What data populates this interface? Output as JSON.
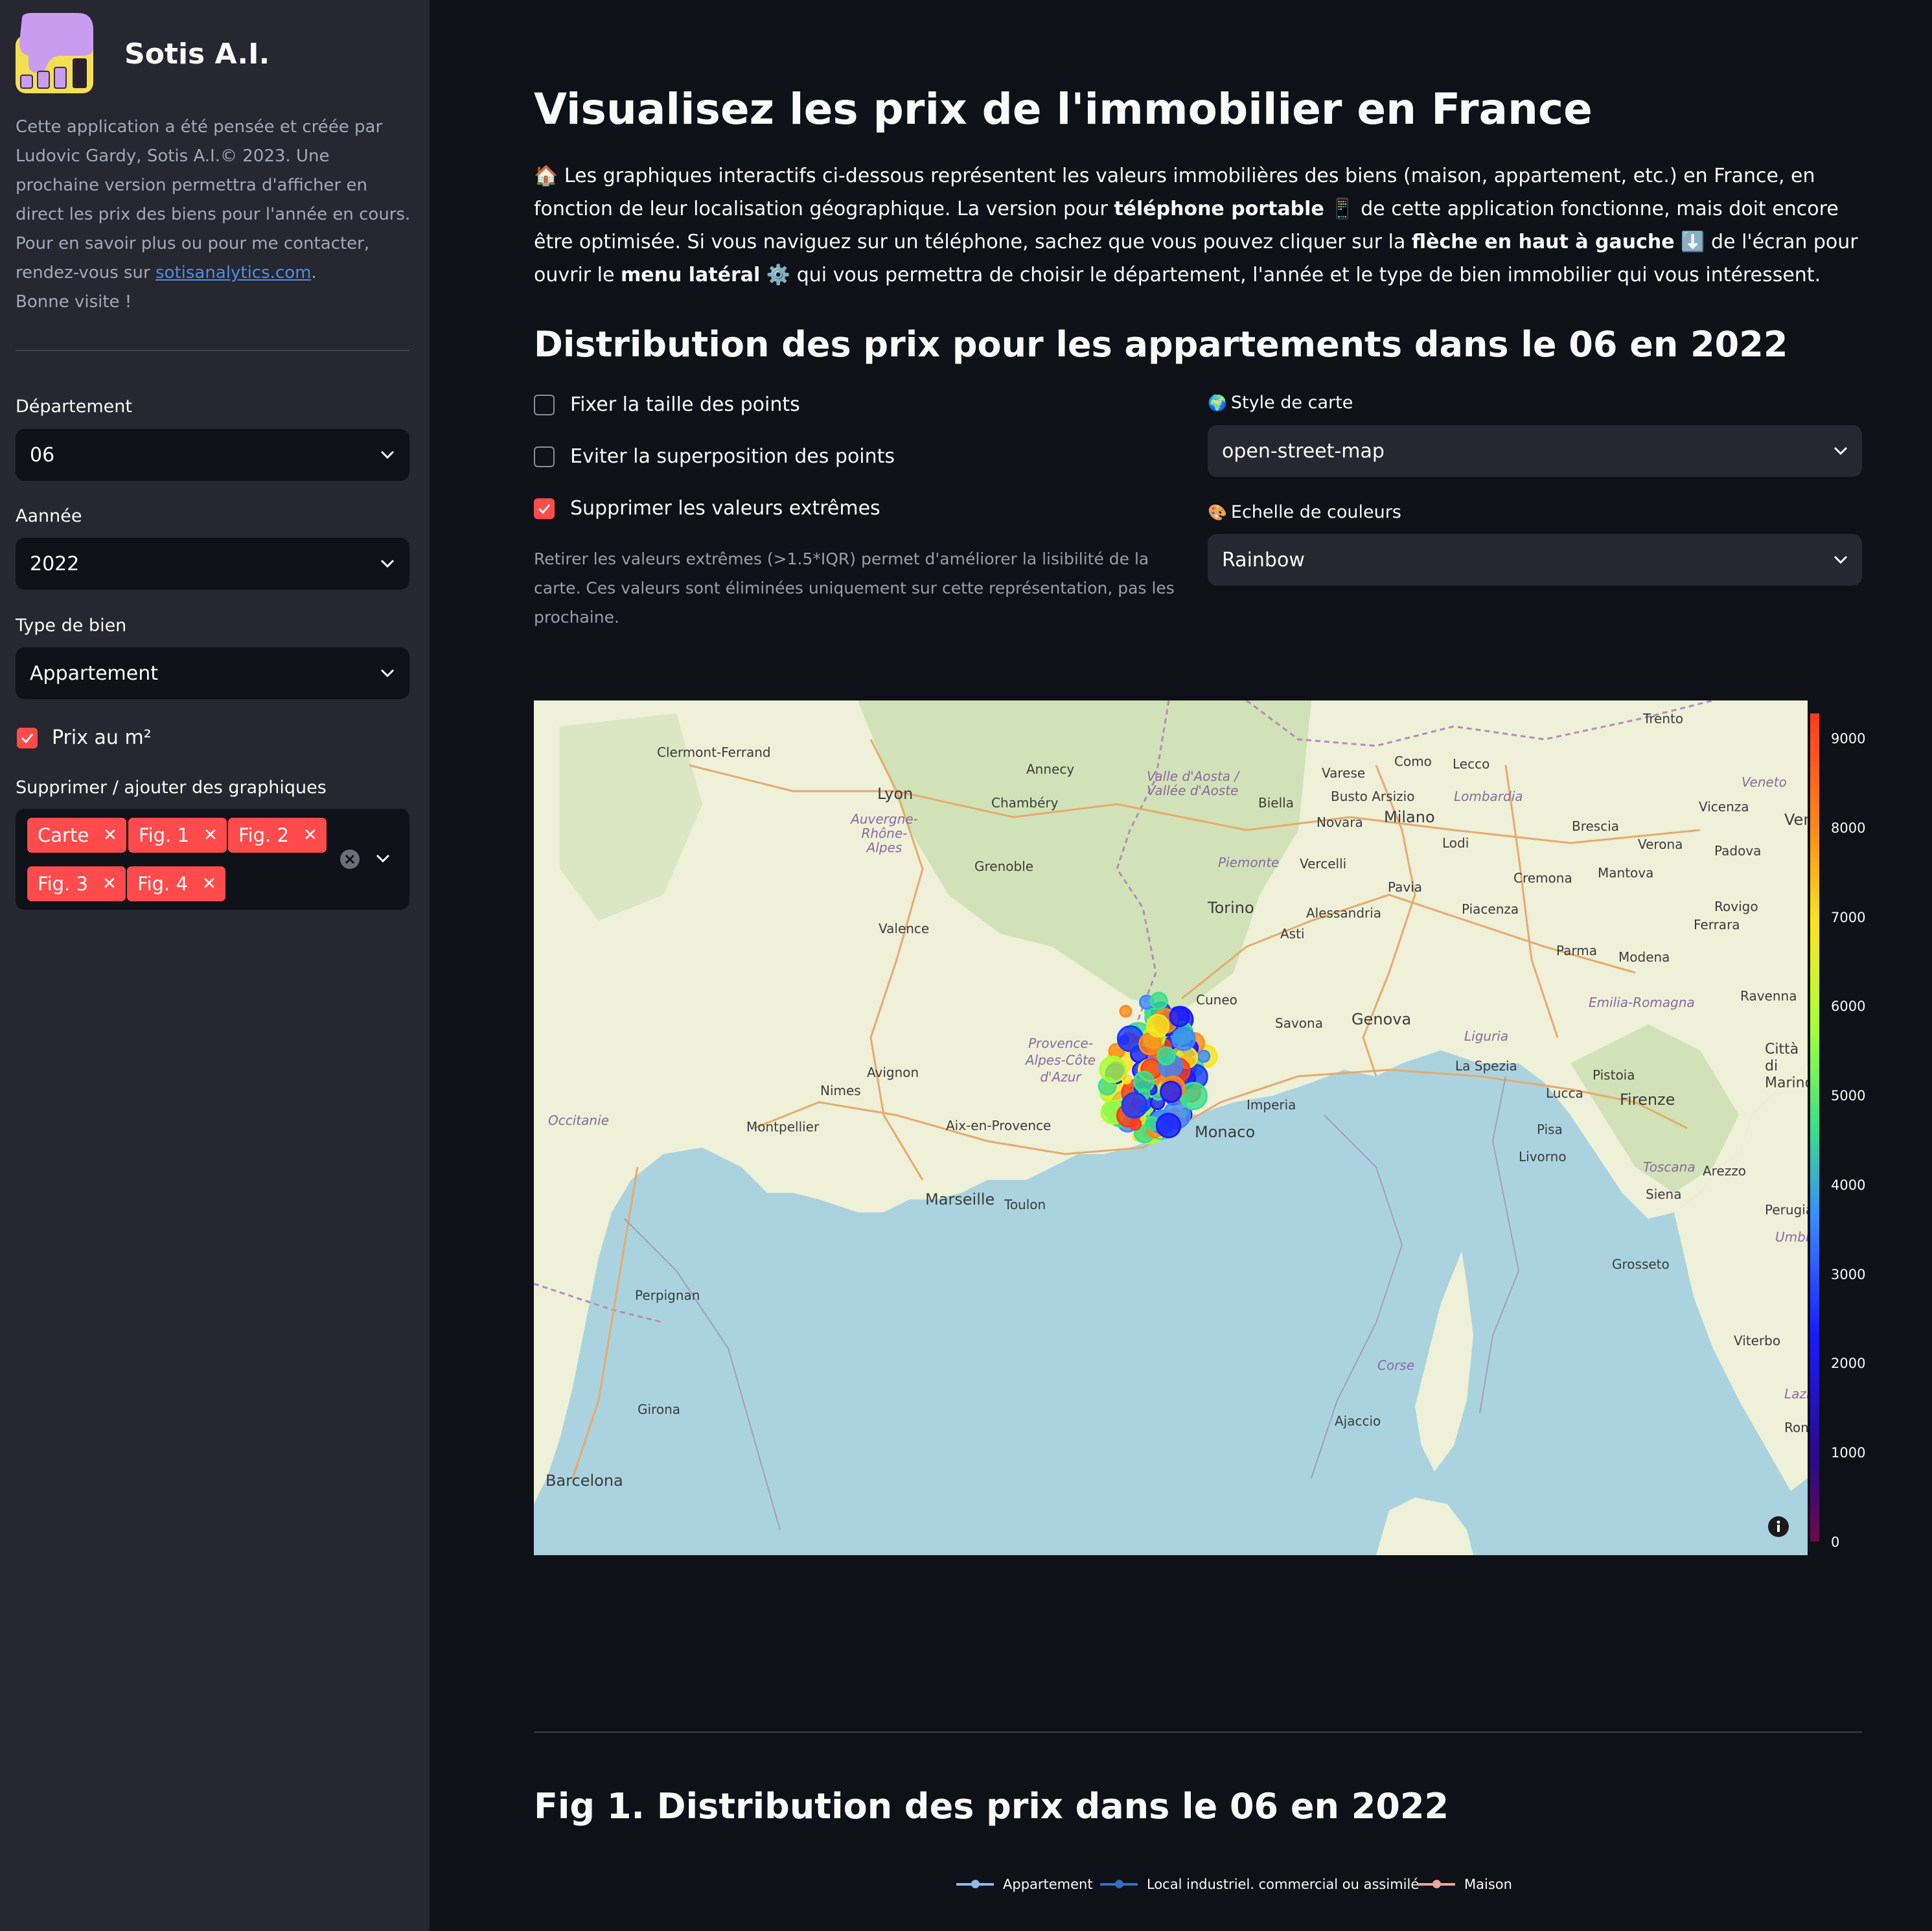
{
  "sidebar": {
    "brand": "Sotis A.I.",
    "intro_text": "Cette application a été pensée et créée par Ludovic Gardy, Sotis A.I.© 2023. Une prochaine version permettra d'afficher en direct les prix des biens pour l'année en cours. Pour en savoir plus ou pour me contacter, rendez-vous sur ",
    "intro_link": "sotisanalytics.com",
    "intro_after": ".",
    "intro_end": "Bonne visite !",
    "departement_label": "Département",
    "departement_value": "06",
    "annee_label": "Aannée",
    "annee_value": "2022",
    "type_label": "Type de bien",
    "type_value": "Appartement",
    "prix_m2_label": "Prix au m²",
    "prix_m2_checked": true,
    "graphs_label": "Supprimer / ajouter des graphiques",
    "graph_tags": [
      "Carte",
      "Fig. 1",
      "Fig. 2",
      "Fig. 3",
      "Fig. 4"
    ]
  },
  "main": {
    "title": "Visualisez les prix de l'immobilier en France",
    "intro": {
      "icon": "🏠",
      "p1": " Les graphiques interactifs ci-dessous représentent les valeurs immobilières des biens (maison, appartement, etc.) en France, en fonction de leur localisation géographique. La version pour ",
      "b1": "téléphone portable",
      "icon2": "📱",
      "p2": " de cette application fonctionne, mais doit encore être optimisée. Si vous naviguez sur un téléphone, sachez que vous pouvez cliquer sur la ",
      "b2": "flèche en haut à gauche",
      "icon3": "⬇️",
      "p3": " de l'écran pour ouvrir le ",
      "b3": "menu latéral",
      "icon4": "⚙️",
      "p4": " qui vous permettra de choisir le département, l'année et le type de bien immobilier qui vous intéressent."
    },
    "section_title": "Distribution des prix pour les appartements dans le 06 en 2022",
    "options": {
      "fix_size_label": "Fixer la taille des points",
      "fix_size_checked": false,
      "avoid_overlap_label": "Eviter la superposition des points",
      "avoid_overlap_checked": false,
      "remove_outliers_label": "Supprimer les valeurs extrêmes",
      "remove_outliers_checked": true,
      "help_text": "Retirer les valeurs extrêmes (>1.5*IQR) permet d'améliorer la lisibilité de la carte. Ces valeurs sont éliminées uniquement sur cette représentation, pas les prochaine."
    },
    "map_style": {
      "icon": "🌍",
      "label": "Style de carte",
      "value": "open-street-map"
    },
    "color_scale": {
      "icon": "🎨",
      "label": "Echelle de couleurs",
      "value": "Rainbow"
    },
    "colorbar_ticks": [
      "9000",
      "8000",
      "7000",
      "6000",
      "5000",
      "4000",
      "3000",
      "2000",
      "1000",
      "0"
    ],
    "fig1_title": "Fig 1. Distribution des prix dans le 06 en 2022",
    "fig1_legend": [
      {
        "name": "Appartement",
        "color": "#8fb8f0"
      },
      {
        "name": "Local industriel. commercial ou assimilé",
        "color": "#2d6fd0"
      },
      {
        "name": "Maison",
        "color": "#f0a39a"
      }
    ]
  },
  "map": {
    "cities": [
      "Trento",
      "Clermont-Ferrand",
      "Lyon",
      "Annecy",
      "Chambéry",
      "Grenoble",
      "Valence",
      "Biella",
      "Varese",
      "Como",
      "Lecco",
      "Busto Arsizio",
      "Novara",
      "Milano",
      "Brescia",
      "Verona",
      "Vicenza",
      "Padova",
      "Venezia",
      "Lodi",
      "Cremona",
      "Mantova",
      "Vercelli",
      "Pavia",
      "Piacenza",
      "Torino",
      "Alessandria",
      "Asti",
      "Parma",
      "Modena",
      "Rovigo",
      "Ferrara",
      "Cuneo",
      "Savona",
      "Genova",
      "Ravenna",
      "Nimes",
      "Avignon",
      "Montpellier",
      "Aix-en-Provence",
      "Marseille",
      "Toulon",
      "Imperia",
      "Monaco",
      "La Spezia",
      "Pistoia",
      "Lucca",
      "Firenze",
      "Pisa",
      "Livorno",
      "Siena",
      "Arezzo",
      "Perugia",
      "Grosseto",
      "Viterbo",
      "Perpignan",
      "Girona",
      "Barcelona",
      "Ajaccio",
      "Città di Marino",
      "Roma"
    ],
    "regions": [
      "Auvergne-Rhône-Alpes",
      "Valle d'Aosta / Vallée d'Aoste",
      "Lombardia",
      "Veneto",
      "Piemonte",
      "Provence-Alpes-Côte d'Azur",
      "Liguria",
      "Emilia-Romagna",
      "Toscana",
      "Umbria",
      "Lazio",
      "Occitanie",
      "Corse"
    ]
  }
}
